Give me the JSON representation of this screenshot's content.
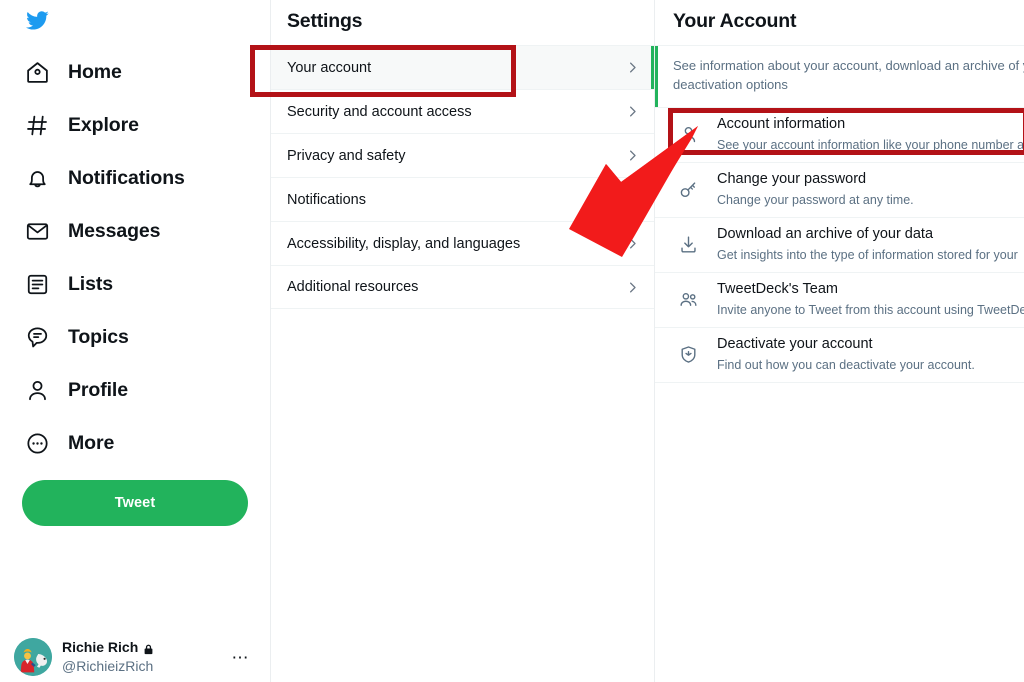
{
  "sidebar": {
    "logo_icon": "twitter-bird-icon",
    "items": [
      {
        "label": "Home",
        "icon": "home-icon"
      },
      {
        "label": "Explore",
        "icon": "hashtag-icon"
      },
      {
        "label": "Notifications",
        "icon": "bell-icon"
      },
      {
        "label": "Messages",
        "icon": "envelope-icon"
      },
      {
        "label": "Lists",
        "icon": "list-icon"
      },
      {
        "label": "Topics",
        "icon": "topics-speech-bubble-icon"
      },
      {
        "label": "Profile",
        "icon": "person-icon"
      },
      {
        "label": "More",
        "icon": "more-ellipsis-circle-icon"
      }
    ],
    "tweet_button": "Tweet",
    "account": {
      "display_name": "Richie Rich",
      "handle": "@RichieizRich",
      "protected_icon": "lock-icon",
      "avatar_icon": "avatar-image",
      "more_icon": "ellipsis-icon"
    }
  },
  "settings": {
    "title": "Settings",
    "items": [
      {
        "label": "Your account",
        "selected": true,
        "chevron": "chevron-right-icon"
      },
      {
        "label": "Security and account access",
        "selected": false,
        "chevron": "chevron-right-icon"
      },
      {
        "label": "Privacy and safety",
        "selected": false,
        "chevron": "chevron-right-icon"
      },
      {
        "label": "Notifications",
        "selected": false,
        "chevron": ""
      },
      {
        "label": "Accessibility, display, and languages",
        "selected": false,
        "chevron": "chevron-right-icon"
      },
      {
        "label": "Additional resources",
        "selected": false,
        "chevron": "chevron-right-icon"
      }
    ]
  },
  "detail": {
    "title": "Your Account",
    "description_line1": "See information about your account, download an archive of your da",
    "description_line2": "deactivation options",
    "rows": [
      {
        "title": "Account information",
        "subtitle": "See your account information like your phone number an",
        "icon": "person-icon"
      },
      {
        "title": "Change your password",
        "subtitle": "Change your password at any time.",
        "icon": "key-icon"
      },
      {
        "title": "Download an archive of your data",
        "subtitle": "Get insights into the type of information stored for your",
        "icon": "download-icon"
      },
      {
        "title": "TweetDeck's Team",
        "subtitle": "Invite anyone to Tweet from this account using TweetDec",
        "icon": "people-icon"
      },
      {
        "title": "Deactivate your account",
        "subtitle": "Find out how you can deactivate your account.",
        "icon": "deactivate-shield-icon"
      }
    ]
  },
  "annotations": {
    "box_color": "#b31217",
    "arrow_color": "#f21b1b",
    "arrow_icon": "red-pointer-arrow",
    "highlighted_items": [
      "Your account",
      "Account information"
    ]
  },
  "colors": {
    "brand_blue": "#1d9bf0",
    "accent_green": "#22b35c",
    "text_primary": "#0f1419",
    "text_secondary": "#5b7083",
    "annotation_red": "#b31217"
  }
}
